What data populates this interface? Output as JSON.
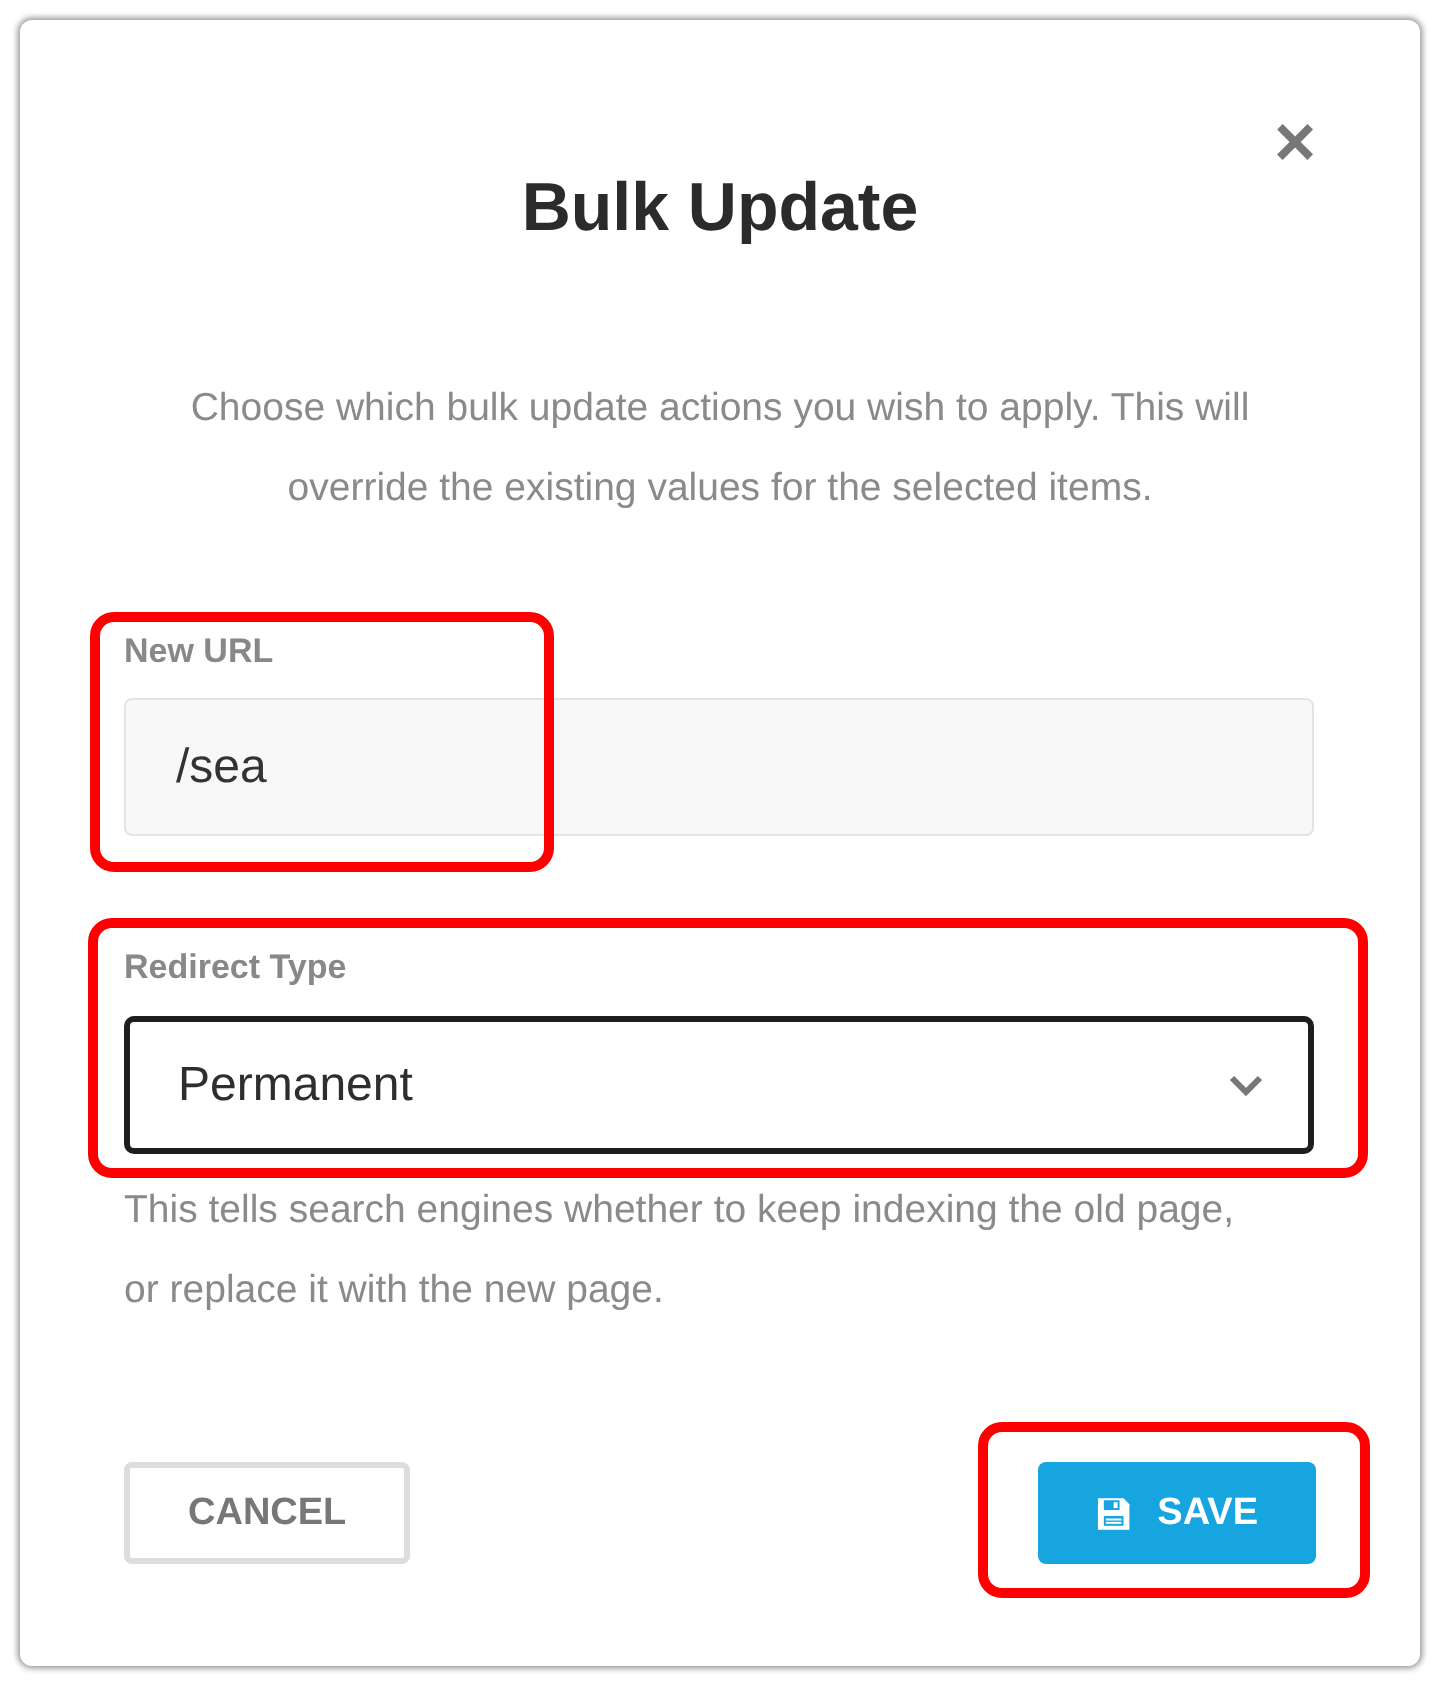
{
  "dialog": {
    "title": "Bulk Update",
    "close_label": "×",
    "description": "Choose which bulk update actions you wish to apply. This will override the existing values for the selected items."
  },
  "new_url": {
    "label": "New URL",
    "value": "/sea",
    "highlighted": true
  },
  "redirect_type": {
    "label": "Redirect Type",
    "value": "Permanent",
    "highlighted": true,
    "hint": "This tells search engines whether to keep indexing the old page, or replace it with the new page."
  },
  "buttons": [
    {
      "kind": "secondary",
      "label": "CANCEL",
      "highlighted": false
    },
    {
      "kind": "primary",
      "label": "SAVE",
      "highlighted": true
    }
  ]
}
